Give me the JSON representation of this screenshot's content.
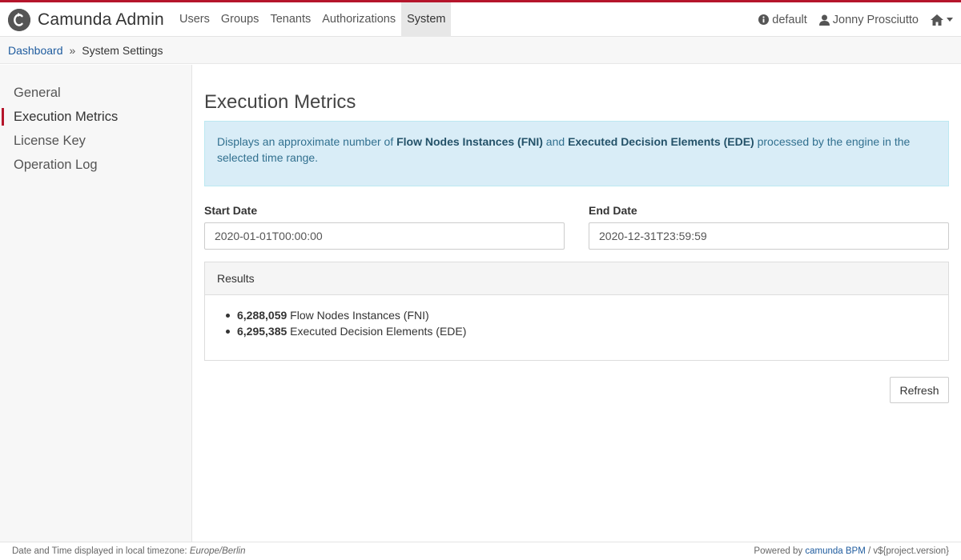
{
  "app": {
    "title": "Camunda Admin",
    "accent_color": "#b5152b"
  },
  "nav": {
    "items": [
      {
        "label": "Users"
      },
      {
        "label": "Groups"
      },
      {
        "label": "Tenants"
      },
      {
        "label": "Authorizations"
      },
      {
        "label": "System",
        "active": true
      }
    ]
  },
  "header_right": {
    "engine": "default",
    "user": "Jonny Prosciutto"
  },
  "breadcrumb": {
    "root": "Dashboard",
    "separator": "»",
    "current": "System Settings"
  },
  "sidebar": {
    "items": [
      {
        "label": "General"
      },
      {
        "label": "Execution Metrics",
        "active": true
      },
      {
        "label": "License Key"
      },
      {
        "label": "Operation Log"
      }
    ]
  },
  "main": {
    "title": "Execution Metrics",
    "info": {
      "prefix": "Displays an approximate number of ",
      "fni": "Flow Nodes Instances (FNI)",
      "and": " and ",
      "ede": "Executed Decision Elements (EDE)",
      "suffix": " processed by the engine in the selected time range."
    },
    "start_date": {
      "label": "Start Date",
      "value": "2020-01-01T00:00:00"
    },
    "end_date": {
      "label": "End Date",
      "value": "2020-12-31T23:59:59"
    },
    "results": {
      "heading": "Results",
      "items": [
        {
          "count": "6,288,059",
          "label": " Flow Nodes Instances (FNI)"
        },
        {
          "count": "6,295,385",
          "label": " Executed Decision Elements (EDE)"
        }
      ]
    },
    "refresh_label": "Refresh"
  },
  "footer": {
    "timezone_prefix": "Date and Time displayed in local timezone: ",
    "timezone": "Europe/Berlin",
    "powered_prefix": "Powered by ",
    "powered_link": "camunda BPM",
    "version": " / v${project.version}"
  }
}
